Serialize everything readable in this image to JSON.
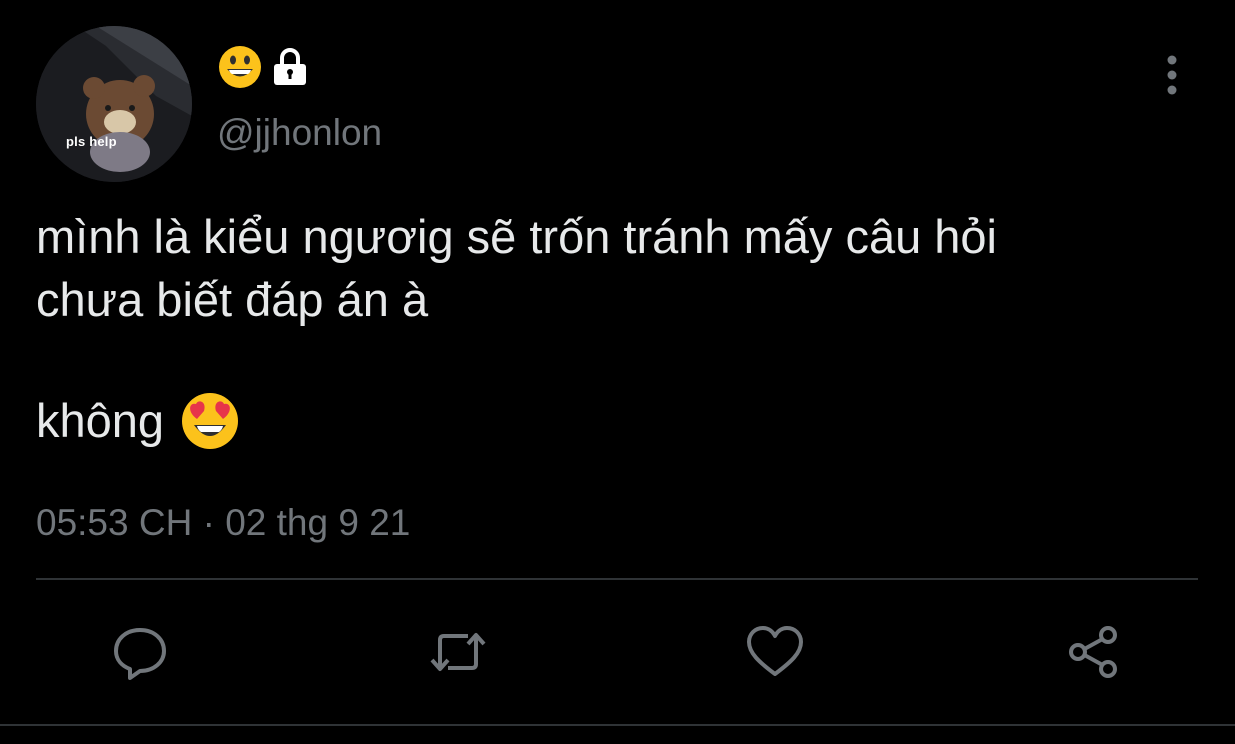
{
  "author": {
    "avatar_caption": "pls help",
    "name_emoji": "grinning-face-emoji",
    "protected_icon": "lock-icon",
    "handle": "@jjhonlon"
  },
  "tweet": {
    "lines": [
      "mình là kiểu ngươig sẽ trốn tránh mấy câu hỏi",
      "chưa biết đáp án à"
    ],
    "final_line": "không",
    "final_emoji": "smiling-face-with-heart-eyes-emoji",
    "time": "05:53 CH",
    "separator": "·",
    "date": "02 thg 9 21"
  },
  "actions": [
    {
      "name": "reply",
      "icon": "speech-bubble-icon"
    },
    {
      "name": "retweet",
      "icon": "retweet-icon"
    },
    {
      "name": "like",
      "icon": "heart-icon"
    },
    {
      "name": "share",
      "icon": "share-icon"
    }
  ],
  "colors": {
    "background": "#000000",
    "primary_text": "#e7e9ea",
    "secondary_text": "#71767b",
    "divider": "#2f3336",
    "emoji_yellow": "#fcc21b"
  }
}
